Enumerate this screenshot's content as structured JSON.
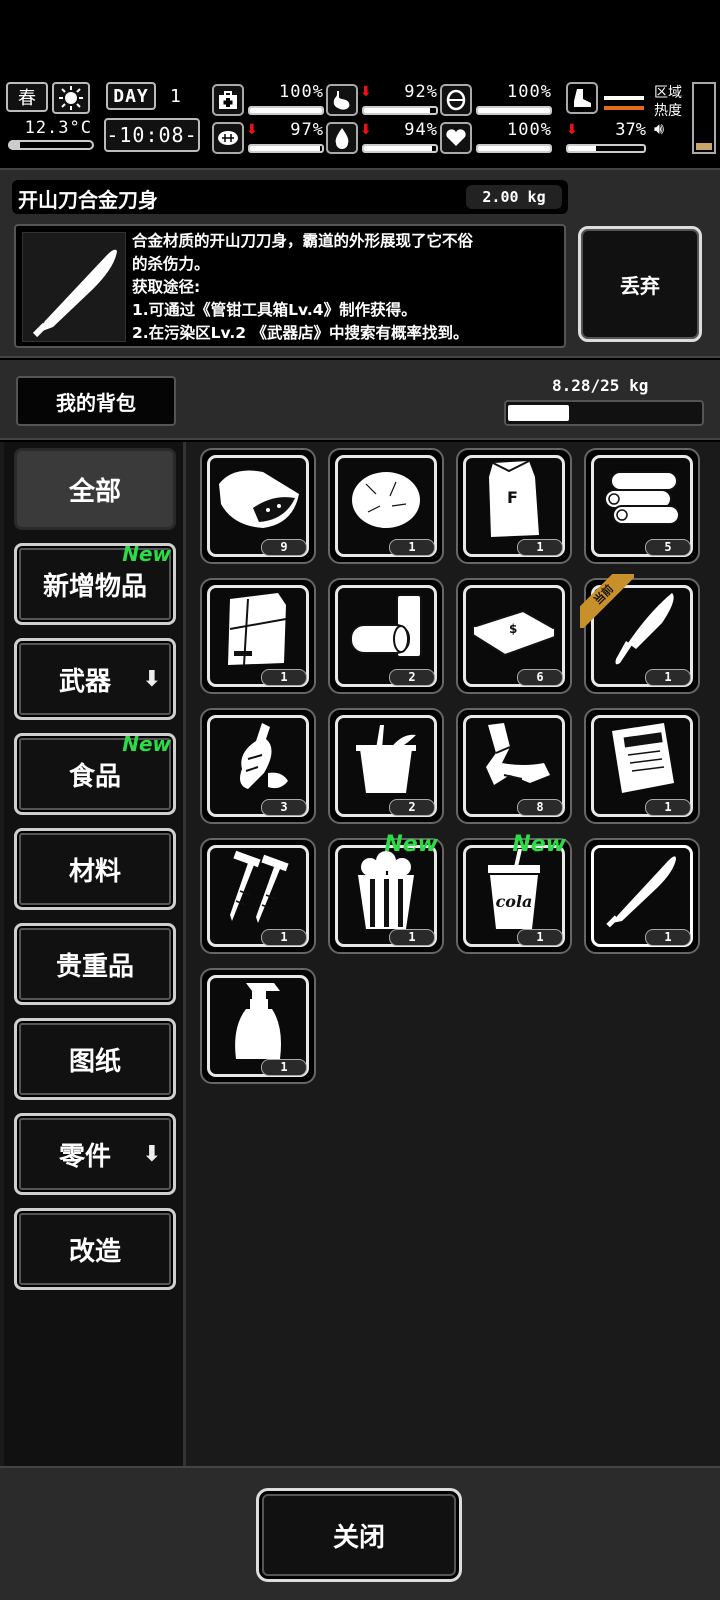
{
  "hud": {
    "season": "春",
    "temperature": "12.3°C",
    "day_label": "DAY",
    "day_number": "1",
    "clock": "-10:08-",
    "stats": [
      {
        "name": "health",
        "icon": "medkit-icon",
        "value": "100%",
        "level": 1.0,
        "down": false
      },
      {
        "name": "hunger",
        "icon": "stomach-icon",
        "value": "92%",
        "level": 0.92,
        "down": true
      },
      {
        "name": "sleep",
        "icon": "helmet-icon",
        "value": "100%",
        "level": 1.0,
        "down": false
      },
      {
        "name": "mood",
        "icon": "brain-icon",
        "value": "97%",
        "level": 0.97,
        "down": true
      },
      {
        "name": "thirst",
        "icon": "water-drop-icon",
        "value": "94%",
        "level": 0.94,
        "down": true
      },
      {
        "name": "heart",
        "icon": "heart-icon",
        "value": "100%",
        "level": 1.0,
        "down": false
      }
    ],
    "stamina": {
      "icon": "boot-icon",
      "value": "37%",
      "level": 0.37,
      "down": true
    },
    "zone": {
      "line1": "区域",
      "line2": "热度",
      "level": 0.1
    }
  },
  "detail": {
    "name": "开山刀合金刀身",
    "weight": "2.00 kg",
    "description": [
      "合金材质的开山刀刀身，霸道的外形展现了它不俗",
      "的杀伤力。",
      "获取途径:",
      "1.可通过《管钳工具箱Lv.4》制作获得。",
      "2.在污染区Lv.2 《武器店》中搜索有概率找到。"
    ],
    "discard_label": "丢弃"
  },
  "bag": {
    "title": "我的背包",
    "weight": "8.28/25 kg",
    "load_fraction": 0.33
  },
  "categories": [
    {
      "label": "全部",
      "active": true,
      "new": false,
      "expand": false
    },
    {
      "label": "新增物品",
      "active": false,
      "new": true,
      "expand": false
    },
    {
      "label": "武器",
      "active": false,
      "new": false,
      "expand": true
    },
    {
      "label": "食品",
      "active": false,
      "new": true,
      "expand": false
    },
    {
      "label": "材料",
      "active": false,
      "new": false,
      "expand": false
    },
    {
      "label": "贵重品",
      "active": false,
      "new": false,
      "expand": false
    },
    {
      "label": "图纸",
      "active": false,
      "new": false,
      "expand": false
    },
    {
      "label": "零件",
      "active": false,
      "new": false,
      "expand": true
    },
    {
      "label": "改造",
      "active": false,
      "new": false,
      "expand": false
    }
  ],
  "new_badge": "New",
  "current_badge": "当前",
  "items": [
    {
      "icon": "meat-chunk-icon",
      "count": "9"
    },
    {
      "icon": "cotton-ball-icon",
      "count": "1"
    },
    {
      "icon": "flour-sack-icon",
      "count": "1"
    },
    {
      "icon": "logs-icon",
      "count": "5"
    },
    {
      "icon": "scrap-panel-icon",
      "count": "1"
    },
    {
      "icon": "pipes-icon",
      "count": "2"
    },
    {
      "icon": "cash-stack-icon",
      "count": "6"
    },
    {
      "icon": "knife-icon",
      "count": "1",
      "current": true
    },
    {
      "icon": "crushed-bottle-icon",
      "count": "3"
    },
    {
      "icon": "bucket-icon",
      "count": "2"
    },
    {
      "icon": "scrap-metal-icon",
      "count": "8"
    },
    {
      "icon": "paper-packet-icon",
      "count": "1"
    },
    {
      "icon": "screws-icon",
      "count": "1"
    },
    {
      "icon": "popcorn-icon",
      "count": "1",
      "new": true
    },
    {
      "icon": "cola-cup-icon",
      "count": "1",
      "new": true,
      "cup_text": "cola"
    },
    {
      "icon": "machete-blade-icon",
      "count": "1",
      "selected": true
    },
    {
      "icon": "spray-bottle-icon",
      "count": "1"
    }
  ],
  "footer": {
    "close_label": "关闭"
  }
}
